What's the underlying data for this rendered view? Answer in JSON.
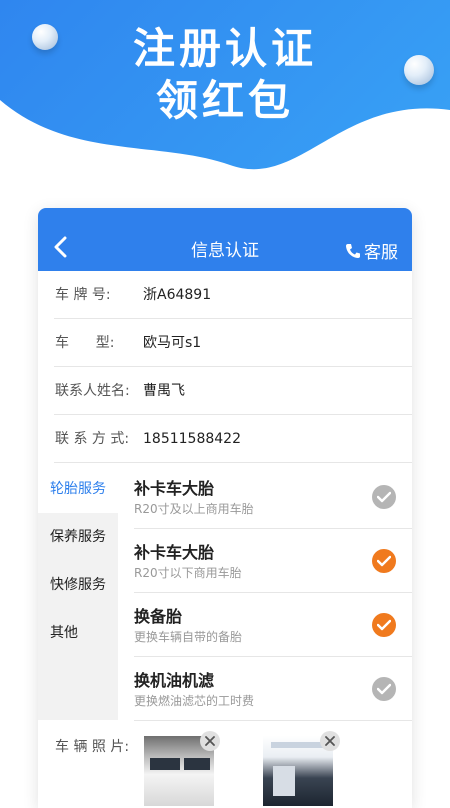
{
  "banner": {
    "line1": "注册认证",
    "line2": "领红包"
  },
  "navbar": {
    "title": "信息认证",
    "service_label": "客服"
  },
  "fields": [
    {
      "label": "车 牌 号:",
      "value": "浙A64891"
    },
    {
      "label": "车      型:",
      "value": "欧马可s1"
    },
    {
      "label": "联系人姓名:",
      "value": "曹禺飞"
    },
    {
      "label": "联 系 方 式:",
      "value": "18511588422"
    }
  ],
  "categories": [
    {
      "label": "轮胎服务",
      "active": true
    },
    {
      "label": "保养服务",
      "active": false
    },
    {
      "label": "快修服务",
      "active": false
    },
    {
      "label": "其他",
      "active": false
    }
  ],
  "services": [
    {
      "title": "补卡车大胎",
      "subtitle": "R20寸及以上商用车胎",
      "checked": false
    },
    {
      "title": "补卡车大胎",
      "subtitle": "R20寸以下商用车胎",
      "checked": true
    },
    {
      "title": "换备胎",
      "subtitle": "更换车辆自带的备胎",
      "checked": true
    },
    {
      "title": "换机油机滤",
      "subtitle": "更换燃油滤芯的工时费",
      "checked": false
    }
  ],
  "photos": {
    "label": "车 辆 照 片:"
  },
  "colors": {
    "primary": "#2f80ec",
    "check_on": "#f07a1e",
    "check_off": "#b5b5b5"
  }
}
